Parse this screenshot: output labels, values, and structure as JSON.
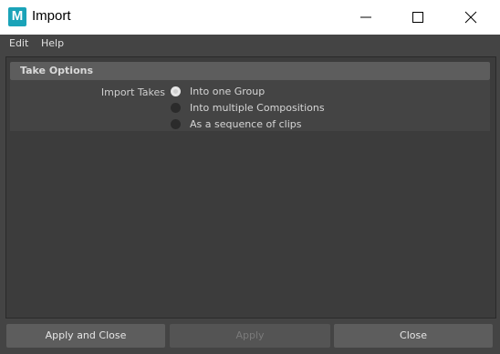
{
  "window": {
    "app_icon": "maya-icon",
    "app_icon_letter": "M",
    "title": "Import",
    "controls": [
      "minimize-icon",
      "maximize-icon",
      "close-icon"
    ]
  },
  "menu": {
    "edit": "Edit",
    "help": "Help"
  },
  "frame": {
    "title": "Take Options",
    "field_label": "Import Takes",
    "options": [
      {
        "label": "Into one Group",
        "selected": true
      },
      {
        "label": "Into multiple Compositions",
        "selected": false
      },
      {
        "label": "As a sequence of clips",
        "selected": false
      }
    ]
  },
  "buttons": {
    "apply_and_close": "Apply and Close",
    "apply": "Apply",
    "apply_enabled": false,
    "close": "Close"
  },
  "colors": {
    "background": "#444444",
    "panel": "#3c3c3c",
    "header": "#5d5d5d",
    "button": "#5d5d5d",
    "accent_icon": "#1aa3b8"
  }
}
